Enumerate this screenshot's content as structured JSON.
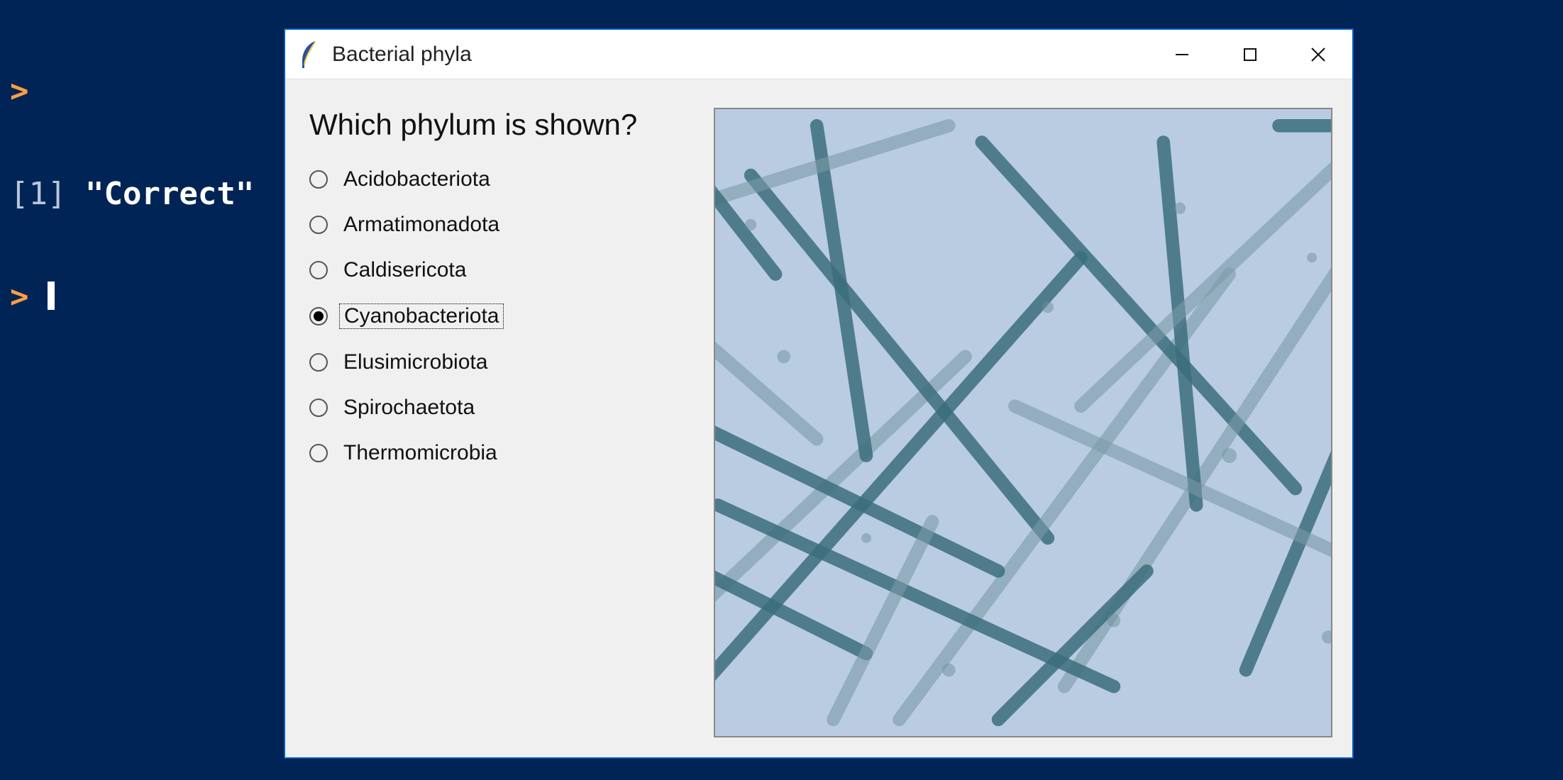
{
  "terminal": {
    "prompt1": ">",
    "output_index": "[1]",
    "output_value": "\"Correct\"",
    "prompt2": ">"
  },
  "dialog": {
    "title": "Bacterial phyla",
    "question": "Which phylum is shown?",
    "options": [
      "Acidobacteriota",
      "Armatimonadota",
      "Caldisericota",
      "Cyanobacteriota",
      "Elusimicrobiota",
      "Spirochaetota",
      "Thermomicrobia"
    ],
    "selected_index": 3
  }
}
